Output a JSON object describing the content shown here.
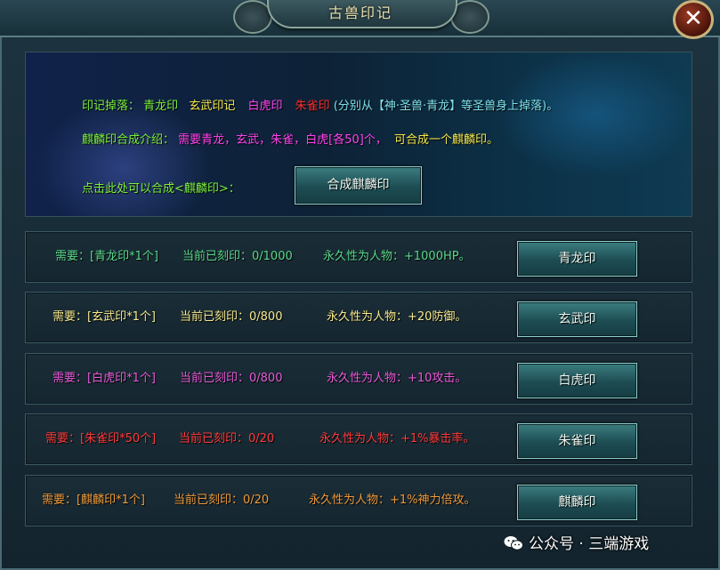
{
  "window": {
    "title": "古兽印记",
    "close_symbol": "✕"
  },
  "info": {
    "drop_prefix": "印记掉落：",
    "drop_seals": [
      {
        "text": "青龙印",
        "color": "#7cf03a"
      },
      {
        "text": "玄武印记",
        "color": "#f4e84a"
      },
      {
        "text": "白虎印",
        "color": "#ff44ee"
      },
      {
        "text": "朱雀印",
        "color": "#ff2f2f"
      }
    ],
    "drop_suffix": "(分别从【神·圣兽·青龙】等圣兽身上掉落)。",
    "intro_label": "麒麟印合成介绍：",
    "intro_requirement": "需要青龙，玄武，朱雀，白虎[各50]个，",
    "intro_result": "可合成一个麒麟印。",
    "click_hint": "点击此处可以合成<麒麟印>：",
    "synth_button": "合成麒麟印"
  },
  "seal_rows": [
    {
      "need": "需要：[青龙印*1个]",
      "progress": "当前已刻印：0/1000",
      "effect": "永久性为人物：+1000HP。",
      "button": "青龙印",
      "color": "#5ad98a"
    },
    {
      "need": "需要：[玄武印*1个]",
      "progress": "当前已刻印：0/800",
      "effect": "永久性为人物：+20防御。",
      "button": "玄武印",
      "color": "#f6e98c"
    },
    {
      "need": "需要：[白虎印*1个]",
      "progress": "当前已刻印：0/800",
      "effect": "永久性为人物：+10攻击。",
      "button": "白虎印",
      "color": "#e85ad8"
    },
    {
      "need": "需要：[朱雀印*50个]",
      "progress": "当前已刻印：0/20",
      "effect": "永久性为人物：+1%暴击率。",
      "button": "朱雀印",
      "color": "#ff3b3b"
    },
    {
      "need": "需要：[麒麟印*1个]",
      "progress": "当前已刻印：0/20",
      "effect": "永久性为人物：+1%神力倍攻。",
      "button": "麒麟印",
      "color": "#ef9a3a"
    }
  ],
  "watermark": {
    "text": "公众号 · 三端游戏",
    "icon": "wechat-icon"
  }
}
